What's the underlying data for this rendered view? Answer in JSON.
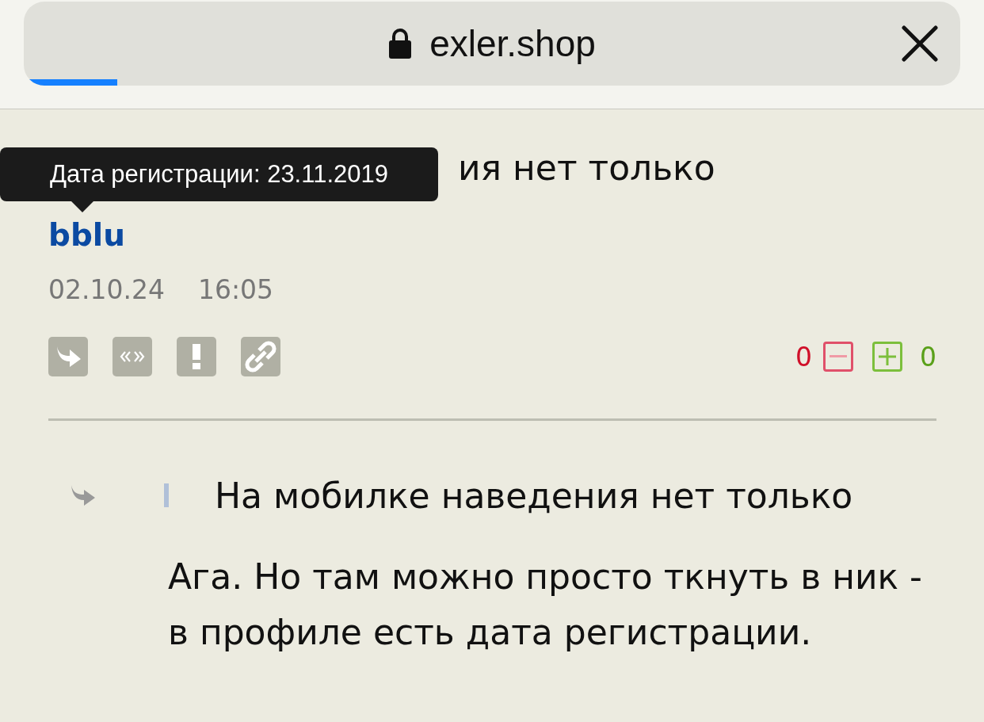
{
  "address_bar": {
    "url": "exler.shop",
    "load_progress": {
      "level": 0.1
    }
  },
  "comment": {
    "quote_tail": "ия нет только",
    "tooltip": "Дата регистрации: 23.11.2019",
    "author": "bblu",
    "date": "02.10.24",
    "time": "16:05",
    "votes": {
      "minus_count": "0",
      "plus_count": "0"
    }
  },
  "reply": {
    "quote": "На мобилке наведения нет только",
    "text": "Ага. Но там можно просто ткнуть в ник - в профиле есть дата регистрации."
  }
}
